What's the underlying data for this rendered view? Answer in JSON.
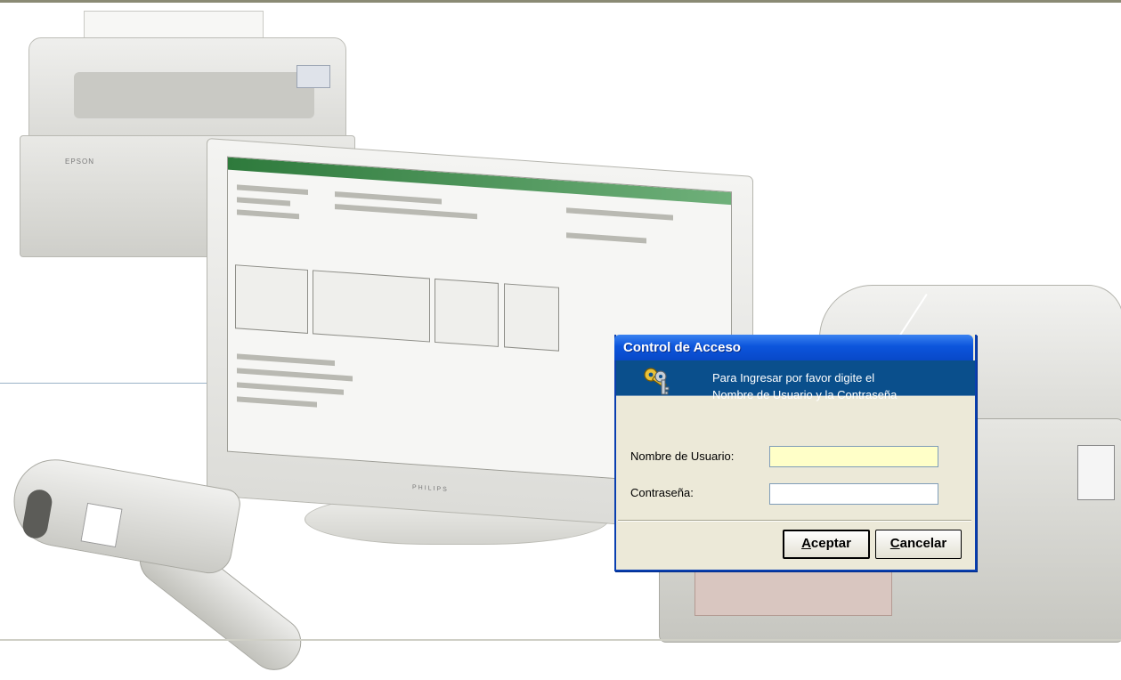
{
  "background": {
    "printer_brand": "EPSON",
    "monitor_brand": "PHILIPS"
  },
  "dialog": {
    "title": "Control de Acceso",
    "header_icon": "keys-icon",
    "message_line1": "Para Ingresar por favor digite el",
    "message_line2": "Nombre de Usuario y la Contraseña",
    "username_label": "Nombre de Usuario:",
    "username_value": "",
    "password_label": "Contraseña:",
    "password_value": "",
    "accept_accel": "A",
    "accept_rest": "ceptar",
    "cancel_accel": "C",
    "cancel_rest": "ancelar"
  },
  "colors": {
    "title_bar": "#0c55dc",
    "header_band": "#0a4f8c",
    "dialog_bg": "#ece9d8",
    "username_bg": "#ffffc8"
  }
}
